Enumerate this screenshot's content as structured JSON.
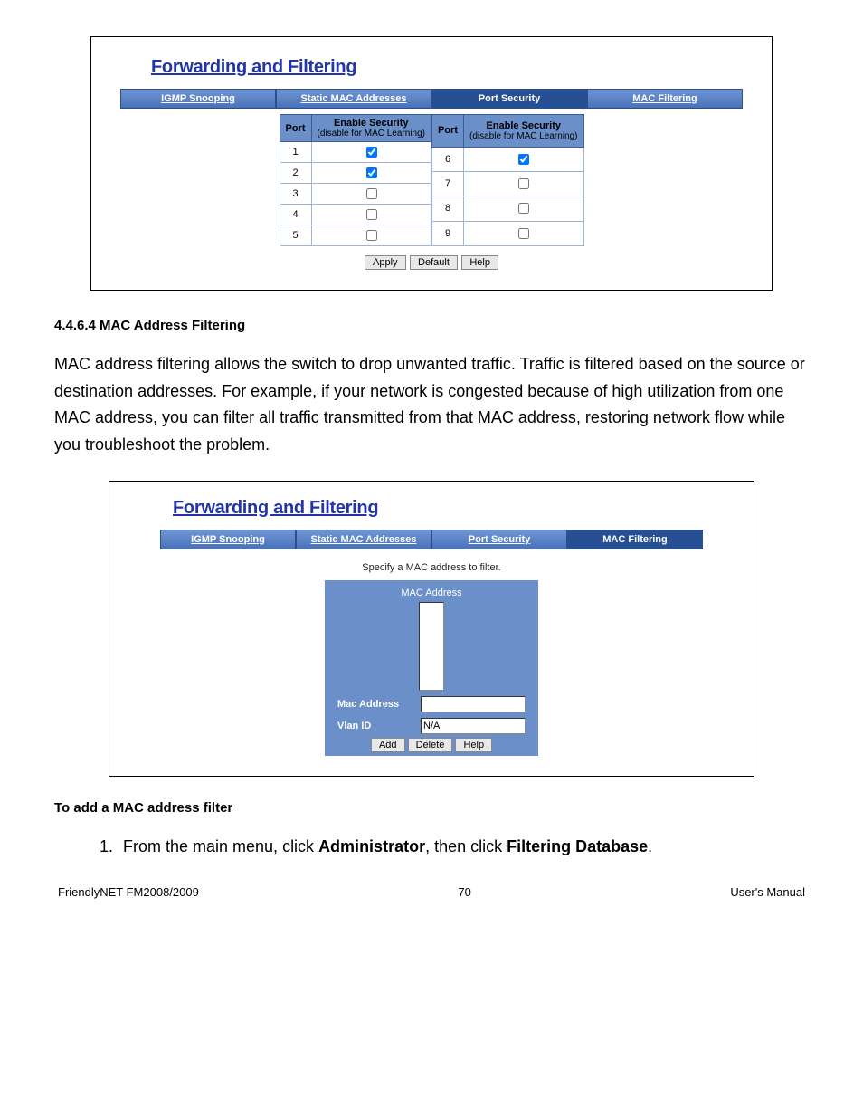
{
  "panel1": {
    "title": "Forwarding and Filtering",
    "tabs": [
      "IGMP Snooping",
      "Static MAC Addresses",
      "Port Security",
      "MAC Filtering"
    ],
    "activeTab": 2,
    "table": {
      "headerPort": "Port",
      "headerEnable": "Enable Security",
      "headerSub": "(disable for MAC Learning)",
      "left": [
        {
          "port": "1",
          "checked": true
        },
        {
          "port": "2",
          "checked": true
        },
        {
          "port": "3",
          "checked": false
        },
        {
          "port": "4",
          "checked": false
        },
        {
          "port": "5",
          "checked": false
        }
      ],
      "right": [
        {
          "port": "6",
          "checked": true
        },
        {
          "port": "7",
          "checked": false
        },
        {
          "port": "8",
          "checked": false
        },
        {
          "port": "9",
          "checked": false
        }
      ]
    },
    "buttons": {
      "apply": "Apply",
      "default": "Default",
      "help": "Help"
    }
  },
  "section1": {
    "heading": "4.4.6.4 MAC Address Filtering"
  },
  "para1": "MAC address filtering allows the switch to drop unwanted traffic. Traffic is filtered based on the source or destination addresses. For example, if your network is congested because of high utilization from one MAC address, you can filter all traffic transmitted from that MAC address, restoring network flow while you troubleshoot the problem.",
  "panel2": {
    "title": "Forwarding and Filtering",
    "tabs": [
      "IGMP Snooping",
      "Static MAC Addresses",
      "Port Security",
      "MAC Filtering"
    ],
    "activeTab": 3,
    "prompt": "Specify a MAC address to filter.",
    "listHeader": "MAC Address",
    "macLabel": "Mac Address",
    "macValue": "",
    "vlanLabel": "Vlan ID",
    "vlanValue": "N/A",
    "buttons": {
      "add": "Add",
      "delete": "Delete",
      "help": "Help"
    }
  },
  "section2": {
    "heading": "To add a MAC address filter"
  },
  "step1": {
    "pre": "From the main menu, click ",
    "b1": "Administrator",
    "mid": ", then click ",
    "b2": "Filtering Database",
    "post": "."
  },
  "footer": {
    "left": "FriendlyNET FM2008/2009",
    "center": "70",
    "right": "User's Manual"
  }
}
